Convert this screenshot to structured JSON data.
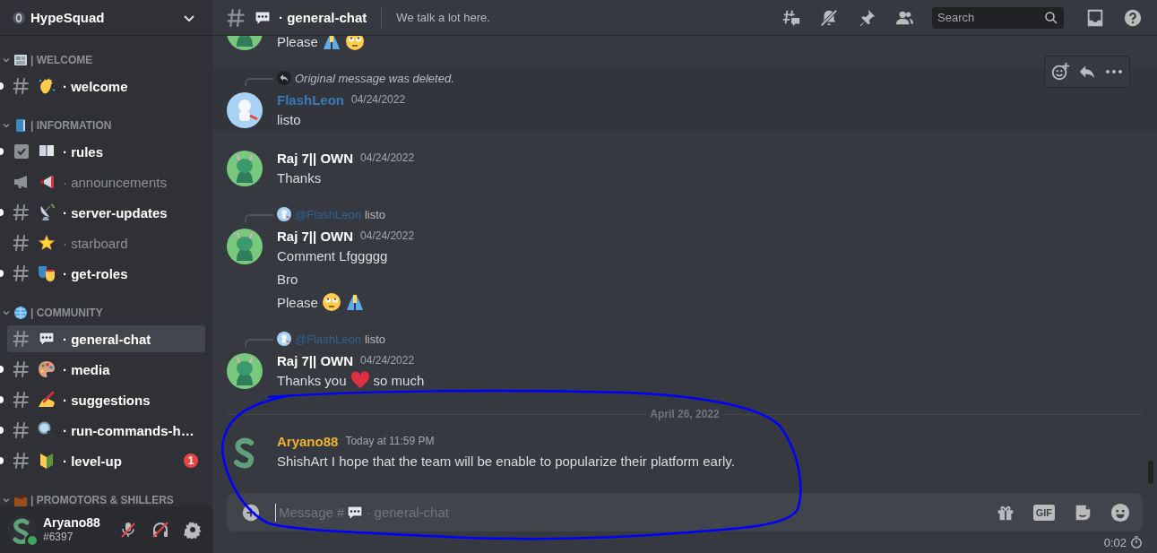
{
  "server": {
    "name": "HypeSquad"
  },
  "categories": [
    {
      "name": "| WELCOME",
      "expanded": true,
      "channels": [
        {
          "kind": "text",
          "name": "· welcome",
          "unread": true,
          "selected": false
        }
      ]
    },
    {
      "name": "| INFORMATION",
      "expanded": true,
      "channels": [
        {
          "kind": "rules",
          "name": "· rules",
          "unread": true,
          "selected": false
        },
        {
          "kind": "announcement",
          "name": "· announcements",
          "unread": false,
          "selected": false
        },
        {
          "kind": "text",
          "name": "· server-updates",
          "unread": true,
          "selected": false
        },
        {
          "kind": "text",
          "name": "· starboard",
          "unread": false,
          "selected": false
        },
        {
          "kind": "text",
          "name": "· get-roles",
          "unread": true,
          "selected": false
        }
      ]
    },
    {
      "name": "| COMMUNITY",
      "expanded": true,
      "channels": [
        {
          "kind": "text",
          "name": "· general-chat",
          "unread": false,
          "selected": true
        },
        {
          "kind": "text",
          "name": "· media",
          "unread": true,
          "selected": false
        },
        {
          "kind": "text",
          "name": "· suggestions",
          "unread": true,
          "selected": false
        },
        {
          "kind": "text",
          "name": "· run-commands-h…",
          "unread": true,
          "selected": false
        },
        {
          "kind": "text",
          "name": "· level-up",
          "unread": true,
          "selected": false,
          "badge": "1"
        }
      ]
    },
    {
      "name": "| PROMOTORS & SHILLERS",
      "expanded": true
    }
  ],
  "user": {
    "name": "Aryano88",
    "tag": "#6397",
    "mic_muted": true,
    "deafened": true
  },
  "header": {
    "channel": "· general-chat",
    "topic": "We talk a lot here.",
    "search_placeholder": "Search"
  },
  "messages": [
    {
      "kind": "message",
      "lines": [
        [
          "Please",
          {
            "kind": "pray"
          },
          {
            "kind": "eyeroll"
          }
        ]
      ]
    },
    {
      "kind": "message",
      "hovered": true,
      "reply": {
        "kind": "deleted",
        "text": "Original message was deleted."
      },
      "author": "FlashLeon",
      "color": "#3b7ab8",
      "timestamp": "04/24/2022",
      "lines": [
        [
          "listo"
        ]
      ]
    },
    {
      "kind": "message",
      "author": "Raj 7|| OWN",
      "color": "#ffffff",
      "timestamp": "04/24/2022",
      "lines": [
        [
          "Thanks"
        ]
      ]
    },
    {
      "kind": "message",
      "reply": {
        "kind": "mention",
        "author": "@FlashLeon",
        "text": "listo"
      },
      "author": "Raj 7|| OWN",
      "color": "#ffffff",
      "timestamp": "04/24/2022",
      "lines": [
        [
          "Comment Lfggggg"
        ],
        [
          "Bro"
        ],
        [
          "Please",
          {
            "kind": "eyeroll"
          },
          {
            "kind": "pray"
          }
        ]
      ]
    },
    {
      "kind": "message",
      "reply": {
        "kind": "mention",
        "author": "@FlashLeon",
        "text": "listo"
      },
      "author": "Raj 7|| OWN",
      "color": "#ffffff",
      "timestamp": "04/24/2022",
      "lines": [
        [
          "Thanks you",
          {
            "kind": "heart"
          },
          "so much"
        ]
      ]
    },
    {
      "kind": "divider",
      "text": "April 26, 2022"
    },
    {
      "kind": "message",
      "author": "Aryano88",
      "color": "#f0b232",
      "timestamp": "Today at 11:59 PM",
      "lines": [
        [
          "ShishArt I hope that the team will be enable to popularize their platform early."
        ]
      ]
    }
  ],
  "composer": {
    "placeholder_before": "Message #",
    "placeholder_after": "· general-chat",
    "gif_label": "GIF",
    "slowmode": "0:02"
  },
  "annotation": {
    "kind": "loop"
  }
}
